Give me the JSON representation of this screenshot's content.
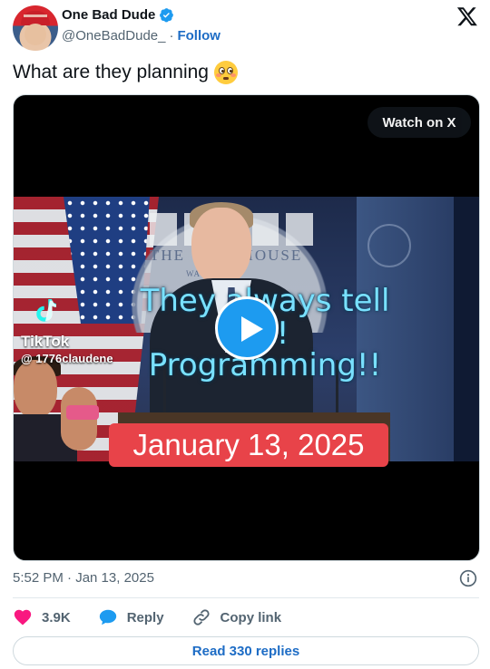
{
  "author": {
    "name": "One Bad Dude",
    "handle": "@OneBadDude_",
    "separator": "·",
    "follow_label": "Follow"
  },
  "brand_icon": "x-logo-icon",
  "tweet": {
    "text": "What are they planning",
    "emoji": "flushed-face-emoji"
  },
  "video": {
    "watch_label": "Watch on X",
    "overlay_line1": "They always tell us!",
    "overlay_line2": "Programming!!",
    "podium_sign_main": "THE",
    "podium_sign_house": "HOUSE",
    "podium_sign_sub": "WA         TON",
    "tiktok_brand": "TikTok",
    "tiktok_handle": "@ 1776claudene",
    "date_banner": "January 13, 2025"
  },
  "meta": {
    "timestamp": "5:52 PM · Jan 13, 2025"
  },
  "actions": {
    "like_count": "3.9K",
    "reply_label": "Reply",
    "copy_label": "Copy link"
  },
  "replies_button": "Read 330 replies",
  "colors": {
    "accent": "#1d9bf0",
    "like": "#f91880",
    "link": "#1d6cc5",
    "date_banner": "#e84349"
  }
}
